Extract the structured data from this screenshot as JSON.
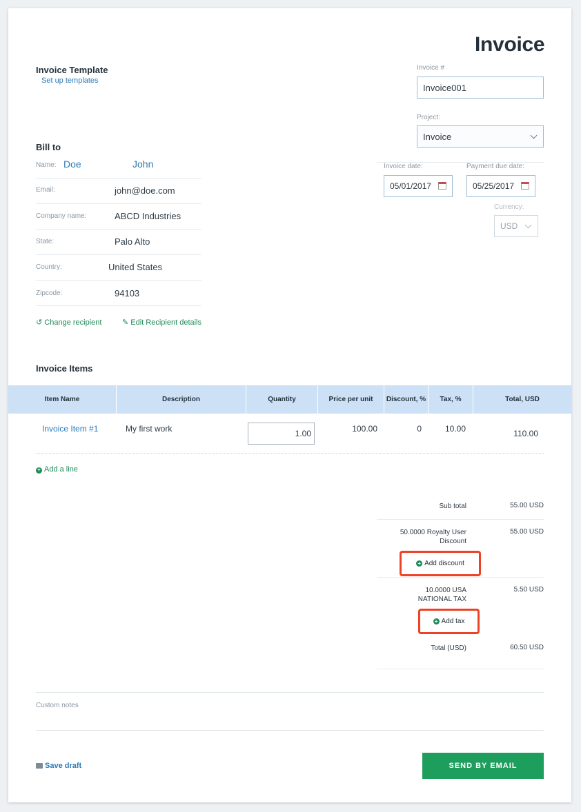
{
  "header": {
    "title": "Invoice",
    "template_title": "Invoice Template",
    "setup_templates": "Set up templates"
  },
  "meta": {
    "invoice_no_label": "Invoice #",
    "invoice_no_value": "Invoice001",
    "project_label": "Project:",
    "project_value": "Invoice",
    "invoice_date_label": "Invoice date:",
    "invoice_date_value": "05/01/2017",
    "due_date_label": "Payment due date:",
    "due_date_value": "05/25/2017",
    "currency_label": "Currency:",
    "currency_value": "USD"
  },
  "bill_to": {
    "title": "Bill to",
    "name_label": "Name:",
    "last_name": "Doe",
    "first_name": "John",
    "email_label": "Email:",
    "email": "john@doe.com",
    "company_label": "Company name:",
    "company": "ABCD Industries",
    "state_label": "State:",
    "state": "Palo Alto",
    "country_label": "Country:",
    "country": "United States",
    "zip_label": "Zipcode:",
    "zip": "94103",
    "change_recipient": "Change recipient",
    "edit_recipient": "Edit Recipient details"
  },
  "items": {
    "title": "Invoice Items",
    "columns": [
      "Item Name",
      "Description",
      "Quantity",
      "Price per unit",
      "Discount, %",
      "Tax, %",
      "Total, USD"
    ],
    "rows": [
      {
        "name": "Invoice Item #1",
        "description": "My first work",
        "quantity": "1.00",
        "price": "100.00",
        "discount": "0",
        "tax": "10.00",
        "total": "110.00"
      }
    ],
    "add_line": "Add a line"
  },
  "summary": {
    "subtotal_label": "Sub total",
    "subtotal_value": "55.00 USD",
    "discount_label_1": "50.0000 Royalty User",
    "discount_label_2": "Discount",
    "discount_value": "55.00 USD",
    "add_discount": "Add discount",
    "tax_label_1": "10.0000 USA",
    "tax_label_2": "NATIONAL TAX",
    "tax_value": "5.50 USD",
    "add_tax": "Add tax",
    "total_label": "Total (USD)",
    "total_value": "60.50 USD"
  },
  "footer": {
    "custom_notes": "Custom notes",
    "save_draft": "Save draft",
    "send_email": "SEND BY EMAIL"
  },
  "colors": {
    "accent_blue": "#2b7bb9",
    "green": "#1e9e5c",
    "highlight": "#ef4123",
    "table_header": "#cce1f5"
  },
  "icons": [
    "calendar-icon",
    "chevron-down-icon",
    "refresh-icon",
    "pencil-icon",
    "plus-circle-icon",
    "folder-icon"
  ]
}
